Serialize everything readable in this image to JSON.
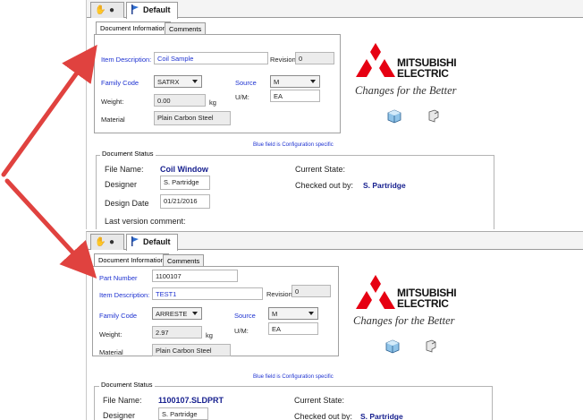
{
  "top": {
    "tab_default": "Default",
    "subtabs": [
      "Document Information",
      "Comments"
    ],
    "item_description_label": "Item Description:",
    "item_description_value": "Coil Sample",
    "revision_label": "Revision:",
    "revision_value": "0",
    "family_code_label": "Family Code",
    "family_code_value": "SATRX",
    "source_label": "Source",
    "source_value": "M",
    "weight_label": "Weight:",
    "weight_value": "0.00",
    "weight_unit": "kg",
    "um_label": "U/M:",
    "um_value": "EA",
    "material_label": "Material",
    "material_value": "Plain Carbon Steel",
    "note": "Blue field is Configuration specific",
    "status_title": "Document Status",
    "file_name_label": "File Name:",
    "file_name_value": "Coil Window",
    "current_state_label": "Current State:",
    "designer_label": "Designer",
    "designer_value": "S. Partridge",
    "checked_out_label": "Checked out by:",
    "checked_out_value": "S. Partridge",
    "design_date_label": "Design Date",
    "design_date_value": "01/21/2016",
    "last_comment_label": "Last version comment:"
  },
  "bottom": {
    "tab_default": "Default",
    "subtabs": [
      "Document Information",
      "Comments"
    ],
    "part_number_label": "Part Number",
    "part_number_value": "1100107",
    "item_description_label": "Item Description:",
    "item_description_value": "TEST1",
    "revision_label": "Revision:",
    "revision_value": "0",
    "family_code_label": "Family Code",
    "family_code_value": "ARRESTE",
    "source_label": "Source",
    "source_value": "M",
    "weight_label": "Weight:",
    "weight_value": "2.97",
    "weight_unit": "kg",
    "um_label": "U/M:",
    "um_value": "EA",
    "material_label": "Material",
    "material_value": "Plain Carbon Steel",
    "note": "Blue field is Configuration specific",
    "status_title": "Document Status",
    "file_name_label": "File Name:",
    "file_name_value": "1100107.SLDPRT",
    "current_state_label": "Current State:",
    "designer_label": "Designer",
    "designer_value": "S. Partridge",
    "checked_out_label": "Checked out by:",
    "checked_out_value": "S. Partridge"
  },
  "logo": {
    "brand_line1": "MITSUBISHI",
    "brand_line2": "ELECTRIC",
    "tagline": "Changes for the Better",
    "brand_color": "#e60012"
  },
  "colors": {
    "config_blue": "#1f33d1",
    "value_navy": "#17208f",
    "arrow_red": "#e0423f"
  }
}
